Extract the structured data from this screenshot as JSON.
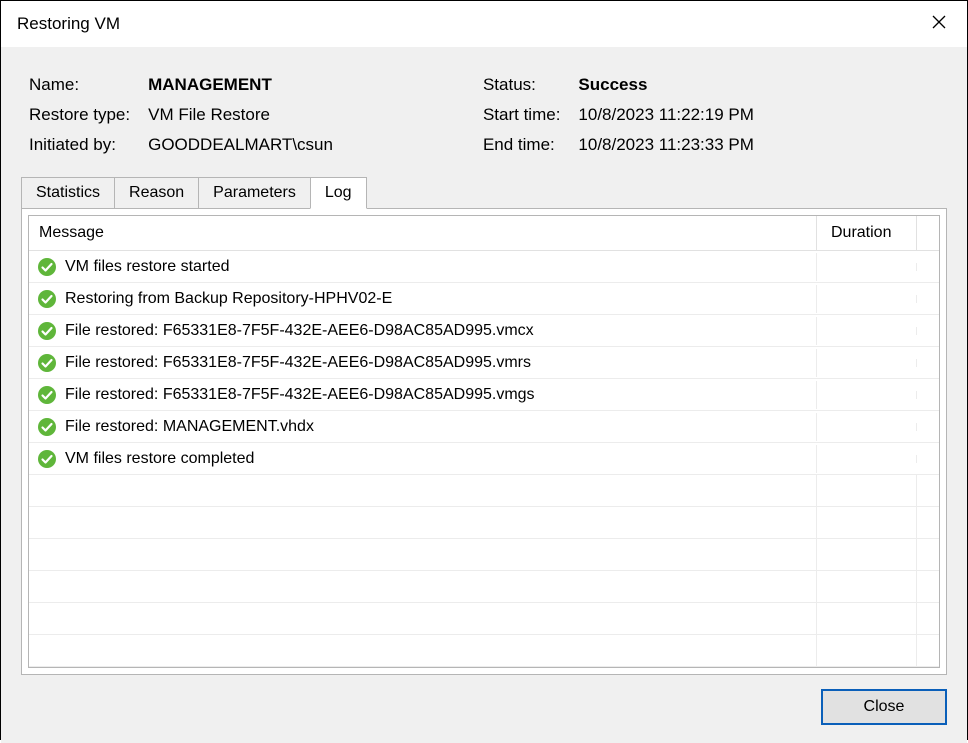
{
  "window": {
    "title": "Restoring VM"
  },
  "info": {
    "name_label": "Name:",
    "name_value": "MANAGEMENT",
    "restore_type_label": "Restore type:",
    "restore_type_value": "VM File Restore",
    "initiated_by_label": "Initiated by:",
    "initiated_by_value": "GOODDEALMART\\csun",
    "status_label": "Status:",
    "status_value": "Success",
    "start_time_label": "Start time:",
    "start_time_value": "10/8/2023 11:22:19 PM",
    "end_time_label": "End time:",
    "end_time_value": "10/8/2023 11:23:33 PM"
  },
  "tabs": {
    "statistics": "Statistics",
    "reason": "Reason",
    "parameters": "Parameters",
    "log": "Log"
  },
  "log": {
    "header_message": "Message",
    "header_duration": "Duration",
    "rows": [
      {
        "status": "success",
        "message": "VM files restore started",
        "duration": ""
      },
      {
        "status": "success",
        "message": "Restoring from Backup Repository-HPHV02-E",
        "duration": ""
      },
      {
        "status": "success",
        "message": "File restored: F65331E8-7F5F-432E-AEE6-D98AC85AD995.vmcx",
        "duration": ""
      },
      {
        "status": "success",
        "message": "File restored: F65331E8-7F5F-432E-AEE6-D98AC85AD995.vmrs",
        "duration": ""
      },
      {
        "status": "success",
        "message": "File restored: F65331E8-7F5F-432E-AEE6-D98AC85AD995.vmgs",
        "duration": ""
      },
      {
        "status": "success",
        "message": "File restored: MANAGEMENT.vhdx",
        "duration": ""
      },
      {
        "status": "success",
        "message": "VM files restore completed",
        "duration": ""
      }
    ]
  },
  "buttons": {
    "close": "Close"
  }
}
